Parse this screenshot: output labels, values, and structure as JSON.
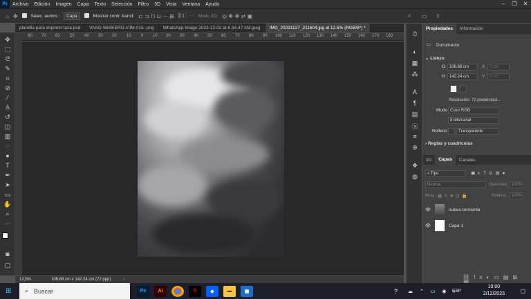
{
  "menu": {
    "app_icon": "Ps",
    "items": [
      "Archivo",
      "Edición",
      "Imagen",
      "Capa",
      "Texto",
      "Selección",
      "Filtro",
      "3D",
      "Vista",
      "Ventana",
      "Ayuda"
    ]
  },
  "options": {
    "auto_select_label": "Selec. autom.:",
    "layer_select": "Capa",
    "show_transform_label": "Mostrar contr. transf.",
    "mode3d_label": "Modo 3D:"
  },
  "tabs": [
    "plantilla para imprimir taza.psd",
    "VASO-WISKERO-VJM-015-.png",
    "WhatsApp Image 2023-12-02 at 6.34.47 AM.jpeg",
    "IMG_20231127_211604.jpg al 12.5% (RGB/8*) *"
  ],
  "ruler_labels": [
    "80",
    "70",
    "60",
    "50",
    "40",
    "30",
    "20",
    "10",
    "0",
    "10",
    "20",
    "30",
    "40",
    "50",
    "60",
    "70",
    "80",
    "90",
    "100",
    "110",
    "120",
    "130",
    "140",
    "150",
    "160",
    "170",
    "180"
  ],
  "status": {
    "zoom": "12,5%",
    "doc_size": "106.68 cm x 142.24 cm (72 ppp)"
  },
  "properties": {
    "tab_active": "Propiedades",
    "tab_other": "Información",
    "section_doc": "Documento",
    "section_canvas": "Lienzo",
    "w_label": "O",
    "w_value": "106.68 cm",
    "x_label": "X",
    "x_value": "0 cm",
    "h_label": "H",
    "h_value": "142.24 cm",
    "y_label": "Y",
    "y_value": "0 cm",
    "resolution": "Resolución: 72 píxeles/pul...",
    "mode_label": "Modo",
    "mode_value": "Color RGB",
    "depth_value": "8 bits/canal",
    "fill_label": "Relleno",
    "fill_value": "Transparente",
    "guides_label": "Reglas y cuadrículas"
  },
  "layers_panel": {
    "tabs": [
      "3D",
      "Capas",
      "Canales"
    ],
    "filter_type": "Tipo",
    "blend": "Normal",
    "opacity_label": "Opacidad:",
    "opacity_value": "100%",
    "lock_label": "Bloq.:",
    "fill_label": "Relleno:",
    "fill_value": "100%",
    "layers": [
      {
        "name": "nubes-tormenta"
      },
      {
        "name": "Capa 1"
      }
    ]
  },
  "taskbar": {
    "search_placeholder": "Buscar",
    "lang": "ESP",
    "time": "10:00",
    "date": "2/12/2023"
  }
}
